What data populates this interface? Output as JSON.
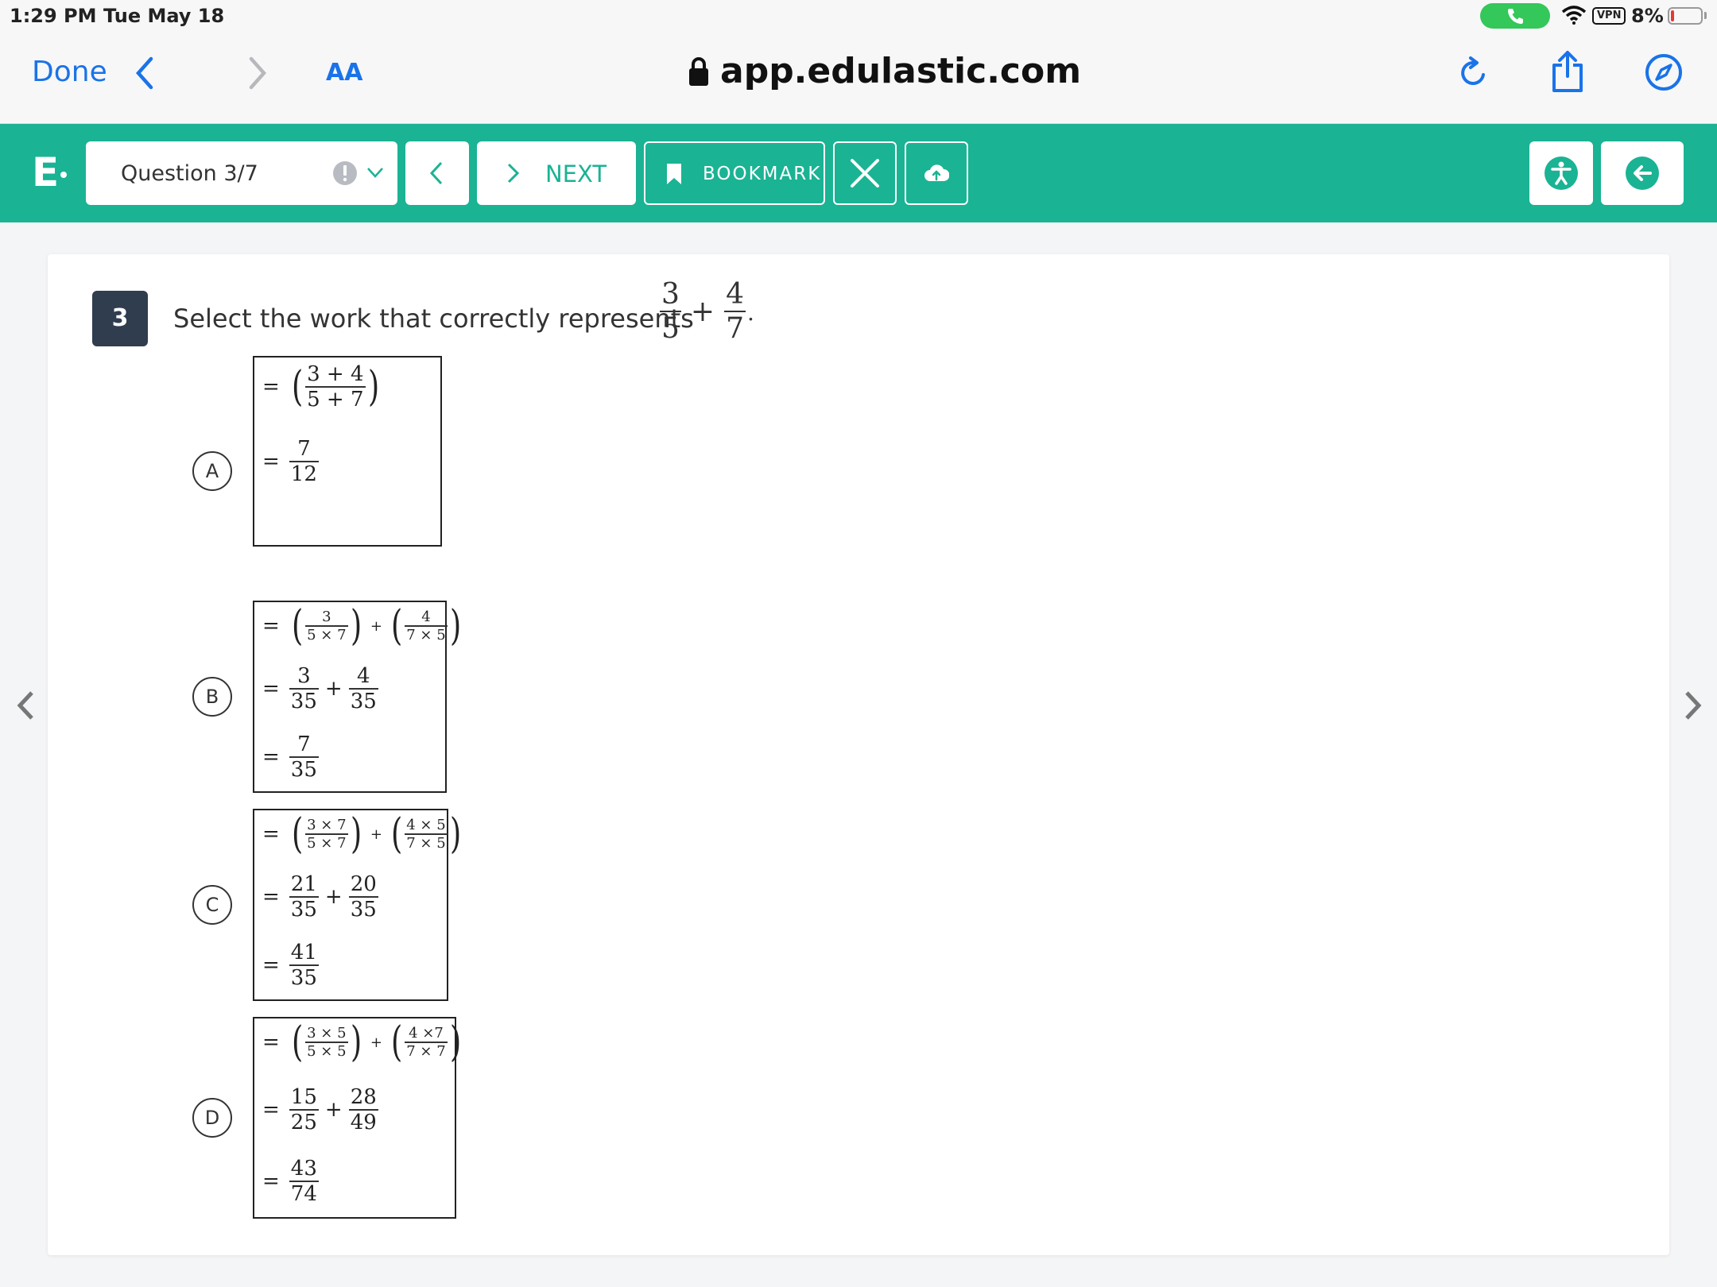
{
  "status_bar": {
    "time": "1:29 PM",
    "date": "Tue May 18",
    "vpn": "VPN",
    "battery": "8%"
  },
  "browser": {
    "done_label": "Done",
    "text_size_label": "AA",
    "url": "app.edulastic.com"
  },
  "toolbar": {
    "logo": "E",
    "question_select": "Question 3/7",
    "next_label": "NEXT",
    "bookmark_label": "BOOKMARK"
  },
  "question": {
    "number": "3",
    "prompt": "Select the work that correctly represents",
    "expression": {
      "a_num": "3",
      "a_den": "5",
      "op": "+",
      "b_num": "4",
      "b_den": "7",
      "end": "."
    },
    "choices": [
      {
        "label": "A",
        "line1": {
          "num": "3 + 4",
          "den": "5 + 7"
        },
        "line2": {
          "num": "7",
          "den": "12"
        }
      },
      {
        "label": "B",
        "line1": {
          "a_num": "3",
          "a_den": "5 × 7",
          "b_num": "4",
          "b_den": "7 × 5"
        },
        "line2": {
          "a_num": "3",
          "a_den": "35",
          "b_num": "4",
          "b_den": "35"
        },
        "line3": {
          "num": "7",
          "den": "35"
        }
      },
      {
        "label": "C",
        "line1": {
          "a_num": "3 × 7",
          "a_den": "5 × 7",
          "b_num": "4 × 5",
          "b_den": "7 × 5"
        },
        "line2": {
          "a_num": "21",
          "a_den": "35",
          "b_num": "20",
          "b_den": "35"
        },
        "line3": {
          "num": "41",
          "den": "35"
        }
      },
      {
        "label": "D",
        "line1": {
          "a_num": "3 × 5",
          "a_den": "5 × 5",
          "b_num": "4 ×7",
          "b_den": "7 × 7"
        },
        "line2": {
          "a_num": "15",
          "a_den": "25",
          "b_num": "28",
          "b_den": "49"
        },
        "line3": {
          "num": "43",
          "den": "74"
        }
      }
    ],
    "eq": "=",
    "plus": "+"
  },
  "colors": {
    "accent": "#1ab394",
    "ios_blue": "#1a73e8",
    "badge": "#2f3d4e"
  }
}
